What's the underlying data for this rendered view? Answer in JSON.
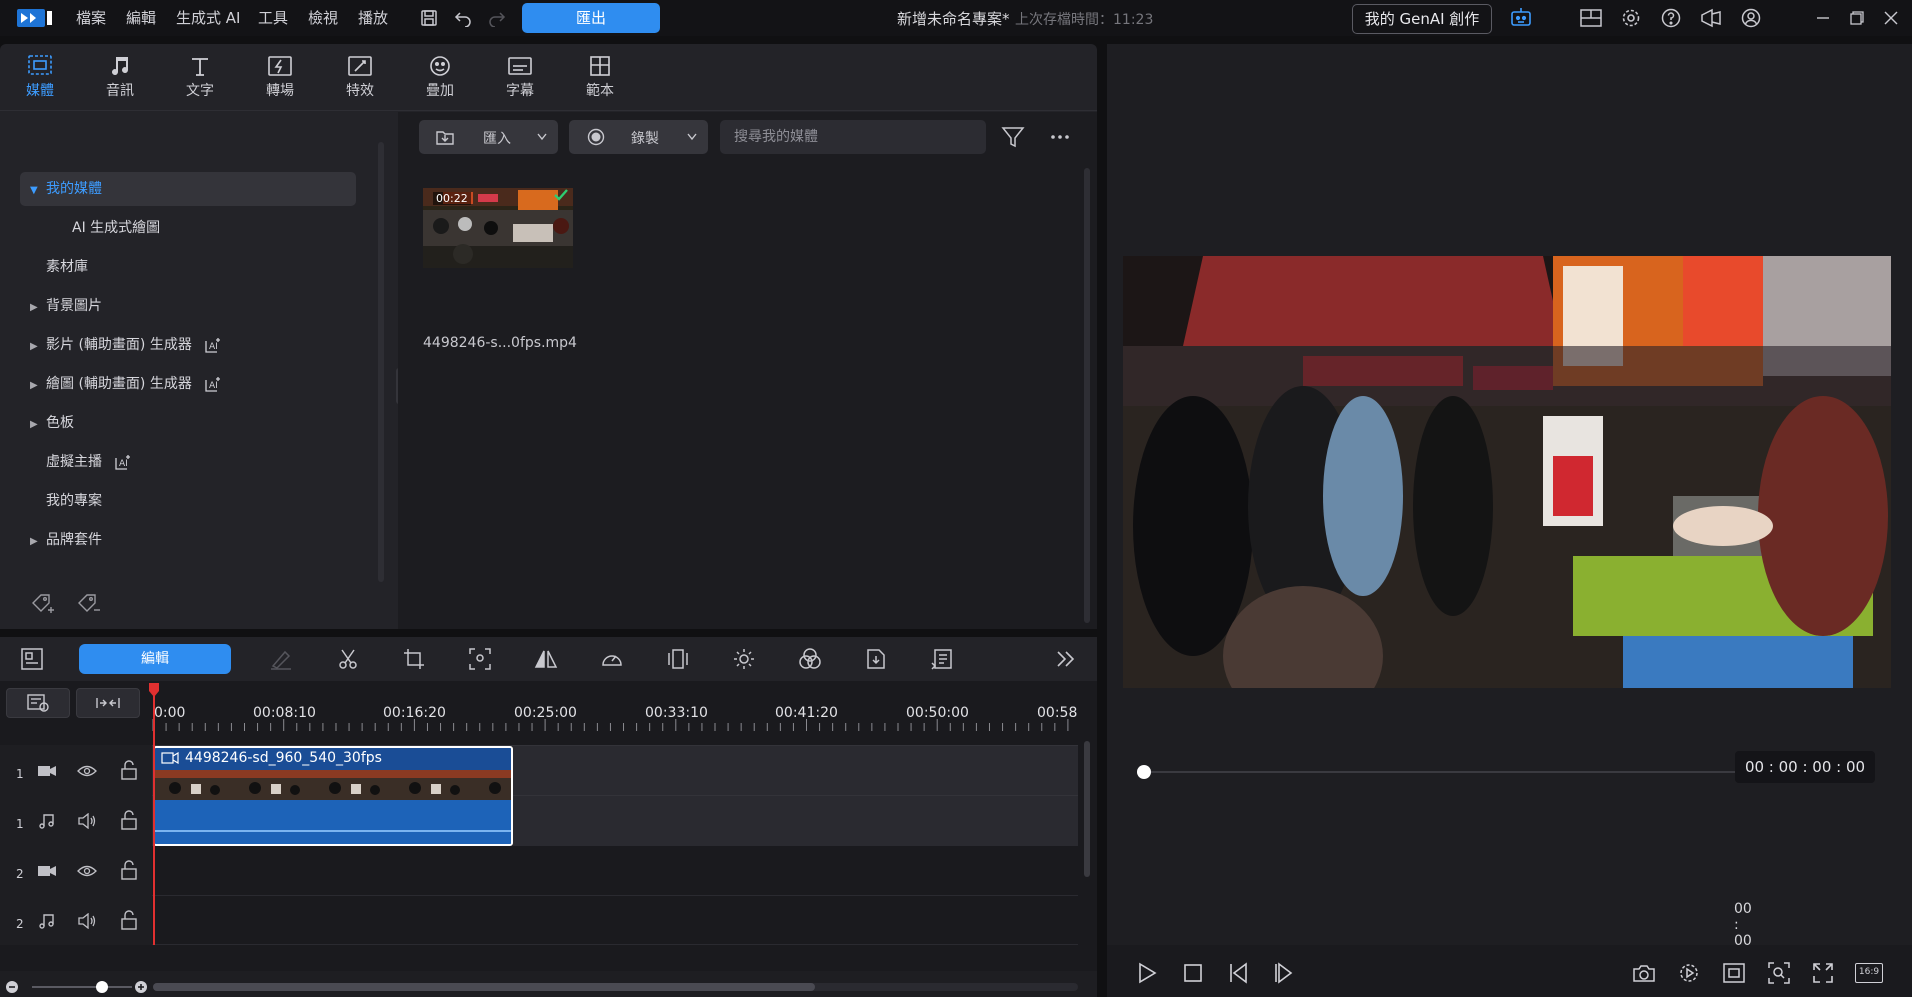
{
  "titlebar": {
    "menus": [
      "檔案",
      "編輯",
      "生成式 AI",
      "工具",
      "檢視",
      "播放"
    ],
    "export_label": "匯出",
    "project_title": "新增未命名專案*",
    "save_time": "上次存檔時間：11:23",
    "genai_label": "我的 GenAI 創作"
  },
  "library": {
    "tabs": [
      "媒體",
      "音訊",
      "文字",
      "轉場",
      "特效",
      "疊加",
      "字幕",
      "範本"
    ],
    "active_tab": "媒體",
    "tree": [
      {
        "label": "我的媒體",
        "arrow": "▼"
      },
      {
        "label": "AI 生成式繪圖",
        "arrow": ""
      },
      {
        "label": "素材庫",
        "arrow": ""
      },
      {
        "label": "背景圖片",
        "arrow": "▶"
      },
      {
        "label": "影片 (輔助畫面) 生成器",
        "arrow": "▶"
      },
      {
        "label": "繪圖 (輔助畫面) 生成器",
        "arrow": "▶"
      },
      {
        "label": "色板",
        "arrow": "▶"
      },
      {
        "label": "虛擬主播",
        "arrow": ""
      },
      {
        "label": "我的專案",
        "arrow": ""
      },
      {
        "label": "品牌套件",
        "arrow": "▶"
      }
    ],
    "import_label": "匯入",
    "record_label": "錄製",
    "search_placeholder": "搜尋我的媒體",
    "media": [
      {
        "duration": "00:22",
        "name": "4498246-s...0fps.mp4"
      }
    ]
  },
  "timeline": {
    "edit_label": "編輯",
    "ruler": [
      "0:00",
      "00:08:10",
      "00:16:20",
      "00:25:00",
      "00:33:10",
      "00:41:20",
      "00:50:00",
      "00:58"
    ],
    "tracks": [
      {
        "num": "1",
        "kind": "video"
      },
      {
        "num": "1",
        "kind": "audio"
      },
      {
        "num": "2",
        "kind": "video"
      },
      {
        "num": "2",
        "kind": "audio"
      }
    ],
    "clip_name": "4498246-sd_960_540_30fps",
    "zoom_level": 0.7
  },
  "preview": {
    "timecode": "00 : 00 : 00 : 00",
    "aspect": "16:9",
    "progress": 0.0
  },
  "colors": {
    "accent": "#2f8df0",
    "active_tab": "#3d9cff",
    "playhead": "#e03030",
    "clip": "#1d63b8"
  }
}
